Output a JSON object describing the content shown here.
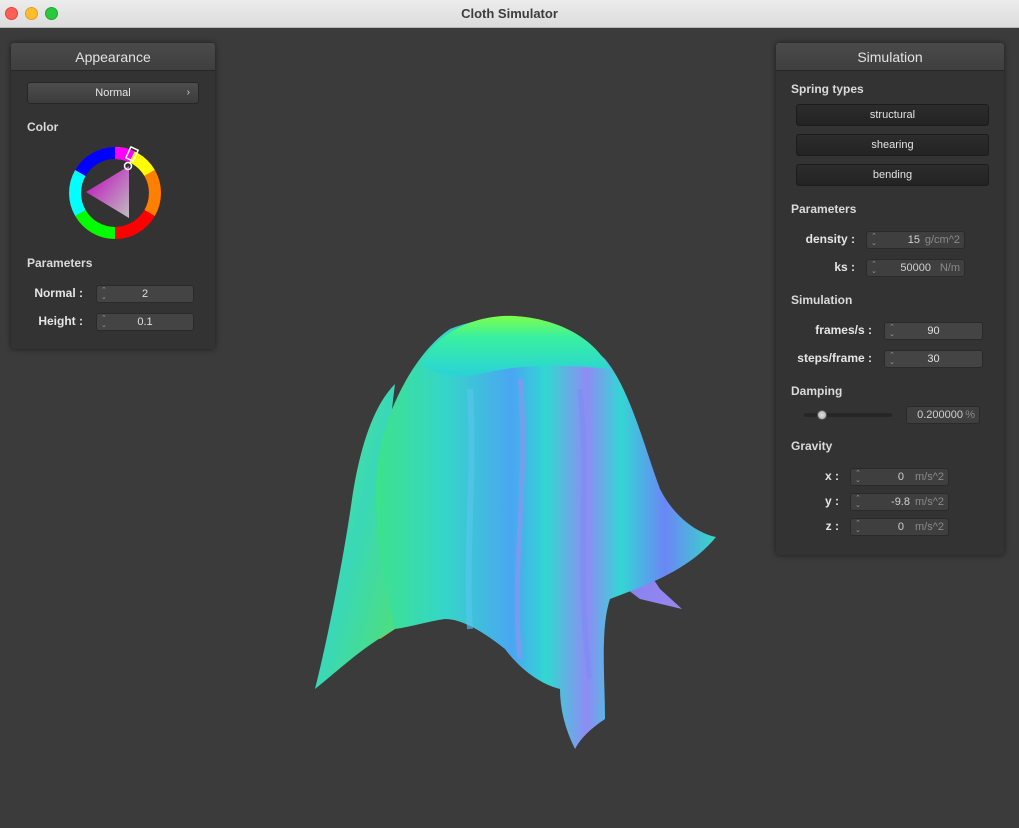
{
  "window": {
    "title": "Cloth Simulator"
  },
  "appearance": {
    "header": "Appearance",
    "shader_dropdown": "Normal",
    "color_label": "Color",
    "parameters_label": "Parameters",
    "normal_label": "Normal :",
    "normal_value": "2",
    "height_label": "Height :",
    "height_value": "0.1"
  },
  "simulation": {
    "header": "Simulation",
    "spring_types_label": "Spring types",
    "structural_label": "structural",
    "shearing_label": "shearing",
    "bending_label": "bending",
    "parameters_label": "Parameters",
    "density_label": "density :",
    "density_value": "15",
    "density_unit": "g/cm^2",
    "ks_label": "ks :",
    "ks_value": "50000",
    "ks_unit": "N/m",
    "simulation_label": "Simulation",
    "fps_label": "frames/s :",
    "fps_value": "90",
    "steps_label": "steps/frame :",
    "steps_value": "30",
    "damping_label": "Damping",
    "damping_value": "0.200000",
    "damping_unit": "%",
    "damping_fraction": 0.2,
    "gravity_label": "Gravity",
    "gx_label": "x :",
    "gx_value": "0",
    "gy_label": "y :",
    "gy_value": "-9.8",
    "gz_label": "z :",
    "gz_value": "0",
    "gravity_unit": "m/s^2"
  },
  "colors": {
    "selected_hue": "#ff00ff",
    "panel_bg": "#333333",
    "viewport_bg": "#3b3b3b"
  }
}
